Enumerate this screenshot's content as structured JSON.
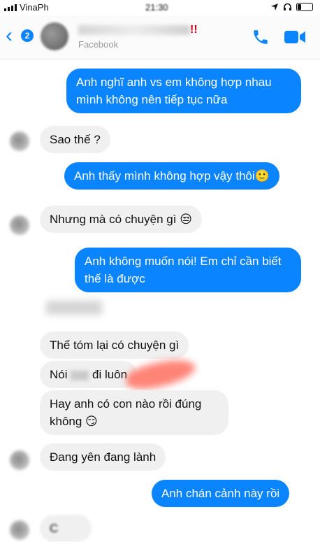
{
  "status_bar": {
    "carrier": "VinaPh",
    "time": "21:30"
  },
  "header": {
    "back_symbol": "‹",
    "unread_count": "2",
    "name_suffix": "!!",
    "subtitle": "Facebook"
  },
  "messages": [
    {
      "side": "out",
      "text": "Anh nghĩ anh vs em không hợp nhau mình không nên tiếp tục nữa"
    },
    {
      "side": "in",
      "text": "Sao thế ?"
    },
    {
      "side": "out",
      "text": "Anh thấy mình không hợp vậy thôi🙂"
    },
    {
      "side": "in",
      "text": "Nhưng mà có chuyện gì 😒"
    },
    {
      "side": "out",
      "text": "Anh không muốn nói! Em chỉ cần biết thế là được"
    },
    {
      "side": "in",
      "text": "Thế tóm lại có chuyện gì"
    },
    {
      "side": "in",
      "text_before": "Nói",
      "text_after": "đi luôn"
    },
    {
      "side": "in",
      "text": "Hay anh có con nào rồi đúng không 😏"
    },
    {
      "side": "in",
      "text": "Đang yên đang lành"
    },
    {
      "side": "out",
      "text": "Anh chán cảnh này rồi"
    },
    {
      "side": "in",
      "text": "C"
    }
  ],
  "colors": {
    "accent": "#0a84ff",
    "incoming_bg": "#f0f0f0",
    "name_suffix": "#d0021b"
  },
  "icons": [
    "back-chevron-icon",
    "phone-icon",
    "video-camera-icon",
    "headphones-icon",
    "location-arrow-icon",
    "battery-icon"
  ]
}
